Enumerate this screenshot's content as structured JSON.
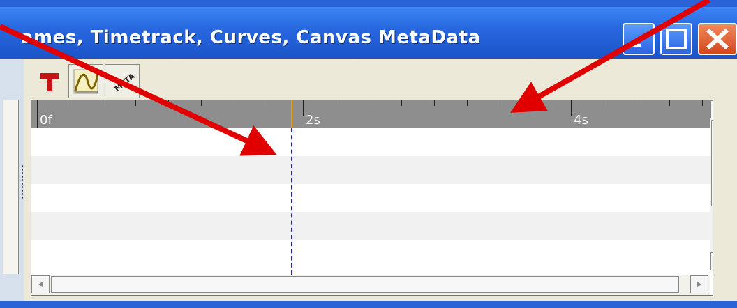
{
  "window": {
    "title": "ames, Timetrack, Curves, Canvas MetaData",
    "buttons": {
      "minimize": "minimize",
      "maximize": "maximize",
      "close": "close"
    }
  },
  "toolbar": {
    "tabs": [
      {
        "icon": "text-t-icon"
      },
      {
        "icon": "curves-icon"
      },
      {
        "icon": "meta-icon",
        "label": "META"
      }
    ]
  },
  "timetrack": {
    "ruler_labels": [
      "0f",
      "2s",
      "4s"
    ],
    "row_count": 5
  },
  "colors": {
    "title_bar": "#2868e0",
    "ruler": "#8e8e8e",
    "cursor": "#2020d0",
    "cursor_marker": "#e8a000",
    "arrow": "#e00000"
  }
}
